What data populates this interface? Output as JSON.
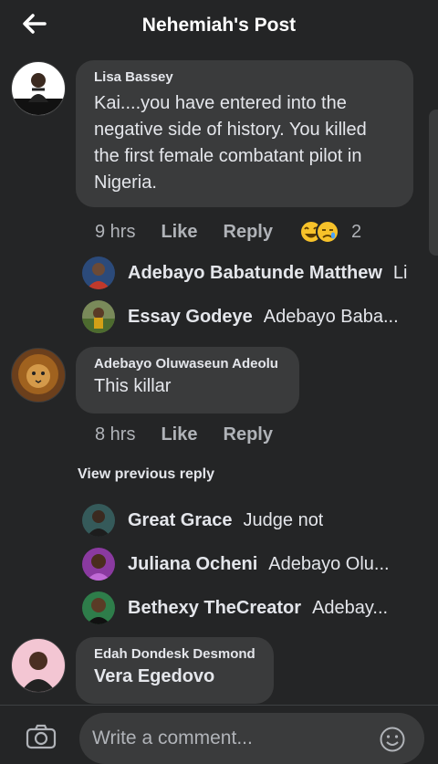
{
  "header": {
    "title": "Nehemiah's Post"
  },
  "comments": [
    {
      "author": "Lisa Bassey",
      "text": "Kai....you have entered into the negative side of history. You killed the first female combatant pilot in Nigeria.",
      "time": "9 hrs",
      "like": "Like",
      "reply": "Reply",
      "reaction_count": "2",
      "replies": [
        {
          "author": "Adebayo Babatunde Matthew",
          "text": "Li"
        },
        {
          "author": "Essay Godeye",
          "text": "Adebayo Baba..."
        }
      ]
    },
    {
      "author": "Adebayo Oluwaseun Adeolu",
      "text": "This killar",
      "time": "8 hrs",
      "like": "Like",
      "reply": "Reply",
      "view_previous": "View previous reply",
      "replies": [
        {
          "author": "Great Grace",
          "text": "Judge not"
        },
        {
          "author": "Juliana Ocheni",
          "text": "Adebayo Olu..."
        },
        {
          "author": "Bethexy TheCreator",
          "text": "Adebay..."
        }
      ]
    },
    {
      "author": "Edah Dondesk Desmond",
      "text": "Vera Egedovo"
    }
  ],
  "footer": {
    "placeholder": "Write a comment..."
  },
  "colors": {
    "background": "#242526",
    "bubble": "#3a3b3c",
    "text": "#e4e6eb",
    "muted": "#b0b3b8"
  }
}
